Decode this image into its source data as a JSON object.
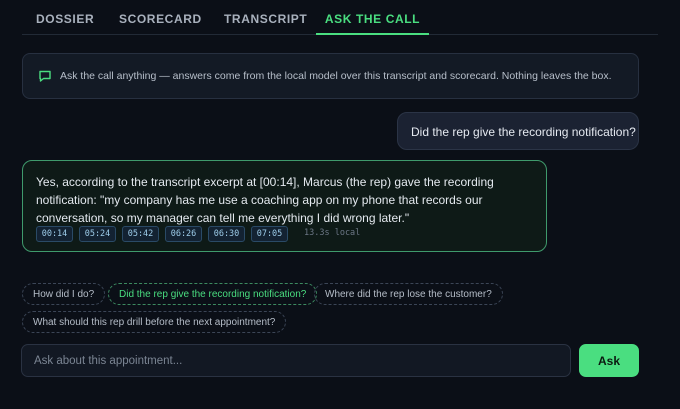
{
  "tabs": [
    {
      "label": "DOSSIER"
    },
    {
      "label": "SCORECARD"
    },
    {
      "label": "TRANSCRIPT"
    },
    {
      "label": "ASK THE CALL",
      "active": true
    }
  ],
  "notice": {
    "icon": "chat-bubble-icon",
    "text": "Ask the call anything — answers come from the local model over this transcript and scorecard. Nothing leaves the box."
  },
  "conversation": {
    "question": "Did the rep give the recording notification?",
    "answer": {
      "text": "Yes, according to the transcript excerpt at [00:14], Marcus (the rep) gave the recording notification: \"my company has me use a coaching app on my phone that records our conversation, so my manager can tell me everything I did wrong later.\"",
      "timestamps": [
        "00:14",
        "05:24",
        "05:42",
        "06:26",
        "06:30",
        "07:05"
      ],
      "latency": "13.3s local"
    }
  },
  "suggestions": [
    {
      "label": "How did I do?"
    },
    {
      "label": "Did the rep give the recording notification?",
      "active": true
    },
    {
      "label": "Where did the rep lose the customer?"
    },
    {
      "label": "What should this rep drill before the next appointment?"
    }
  ],
  "composer": {
    "placeholder": "Ask about this appointment...",
    "value": "",
    "button_label": "Ask"
  },
  "colors": {
    "accent": "#4ade80",
    "background": "#0b0f17"
  }
}
